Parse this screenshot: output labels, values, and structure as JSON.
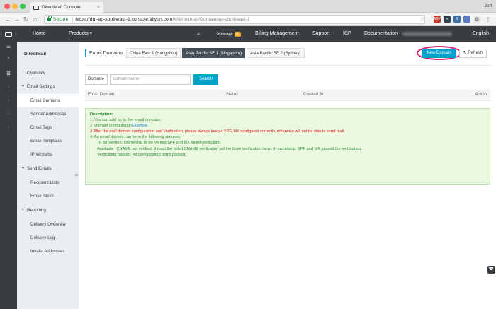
{
  "browser": {
    "tab_title": "DirectMail Console",
    "tab_close": "×",
    "user": "Jeff",
    "secure_label": "Secure",
    "url_host": "https://dm-ap-southeast-1.console.aliyun.com",
    "url_path": "/#/directmail/Domain/ap-southeast-1",
    "extensions": [
      "ABP",
      "≡",
      "S"
    ]
  },
  "header": {
    "home": "Home",
    "products": "Products ▾",
    "message": "Message",
    "message_count": "58",
    "billing": "Billing Management",
    "support": "Support",
    "icp": "ICP",
    "documentation": "Documentation",
    "language": "English"
  },
  "sidebar": {
    "title": "DirectMail",
    "overview": "Overview",
    "email_settings": "Email Settings",
    "email_domains": "Email Domains",
    "sender_addresses": "Sender Addresses",
    "email_tags": "Email Tags",
    "email_templates": "Email Templates",
    "ip_whitelist": "IP Whitelist",
    "send_emails": "Send Emails",
    "recipient_lists": "Recipient Lists",
    "email_tasks": "Email Tasks",
    "reporting": "Reporting",
    "delivery_overview": "Delivery Overview",
    "delivery_log": "Delivery Log",
    "invalid_addresses": "Invalid Addresses"
  },
  "main": {
    "title": "Email Domains",
    "regions": [
      "China East 1 (Hangzhou)",
      "Asia Pacific SE 1 (Singapore)",
      "Asia Pacific SE 2 (Sydney)"
    ],
    "new_domain": "New Domain",
    "refresh": "Refresh",
    "search_select": "Domain",
    "search_placeholder": "domain name",
    "search_button": "Search",
    "columns": [
      "Email Domain",
      "Status",
      "Created At",
      "Action"
    ]
  },
  "description": {
    "title": "Description:",
    "line1": "1. You can add up to five email domains.",
    "line2_prefix": "2. Domain configuration",
    "line2_link": "Example",
    "line2_suffix": ".",
    "line3": "3.After the mail domain configuration and Verification,  please always keep a SPF, MX configured correctly, otherwise will not be able to send mail.",
    "line4": "4. An email domain can be in the following statuses:",
    "line5": "To Be Verified: Ownership to Be VerifiedSPF and MX failed verification.",
    "line6": "Available - CNAME not verified: Except the failed CNAME verification, all the three verification items of ownership, SPF and MX passed the verification.",
    "line7": "Verification passed: All configuration items passed."
  },
  "colors": {
    "header_bg": "#373d41",
    "accent": "#00a2ca",
    "highlight": "#e01e6b",
    "note_bg": "#eaf8e1"
  }
}
